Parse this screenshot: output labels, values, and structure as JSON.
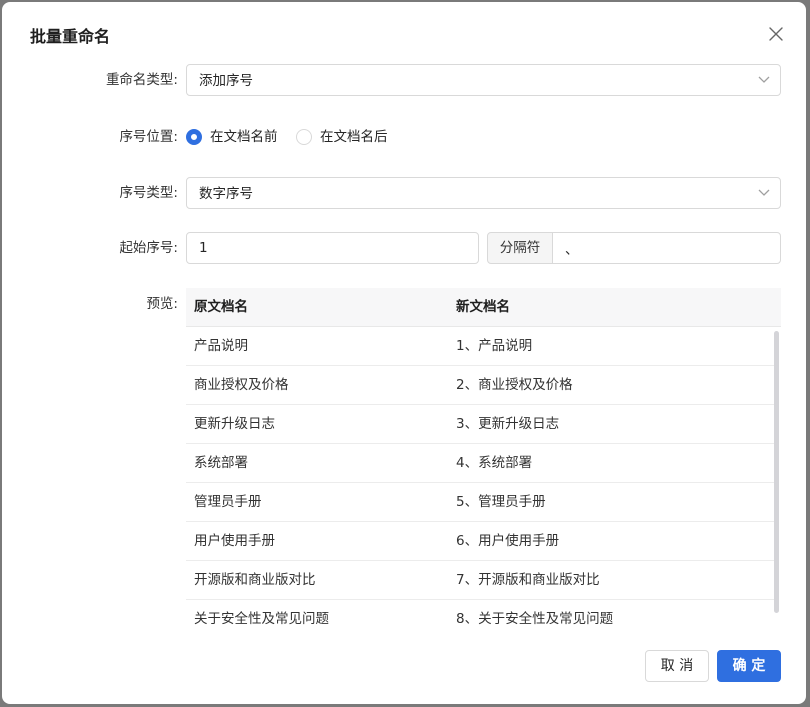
{
  "dialog": {
    "title": "批量重命名",
    "close_icon": "close-icon"
  },
  "form": {
    "rename_type": {
      "label": "重命名类型:",
      "value": "添加序号"
    },
    "position": {
      "label": "序号位置:",
      "options": [
        {
          "label": "在文档名前",
          "checked": true
        },
        {
          "label": "在文档名后",
          "checked": false
        }
      ]
    },
    "number_type": {
      "label": "序号类型:",
      "value": "数字序号"
    },
    "start_number": {
      "label": "起始序号:",
      "value": "1"
    },
    "separator": {
      "addon": "分隔符",
      "value": "、"
    }
  },
  "preview": {
    "label": "预览:",
    "columns": [
      "原文档名",
      "新文档名"
    ],
    "rows": [
      [
        "产品说明",
        "1、产品说明"
      ],
      [
        "商业授权及价格",
        "2、商业授权及价格"
      ],
      [
        "更新升级日志",
        "3、更新升级日志"
      ],
      [
        "系统部署",
        "4、系统部署"
      ],
      [
        "管理员手册",
        "5、管理员手册"
      ],
      [
        "用户使用手册",
        "6、用户使用手册"
      ],
      [
        "开源版和商业版对比",
        "7、开源版和商业版对比"
      ],
      [
        "关于安全性及常见问题",
        "8、关于安全性及常见问题"
      ]
    ]
  },
  "footer": {
    "cancel_label": "取 消",
    "ok_label": "确 定"
  },
  "colors": {
    "accent": "#2f6fe0",
    "border": "#d9d9d9",
    "header_bg": "#f7f7f8"
  }
}
